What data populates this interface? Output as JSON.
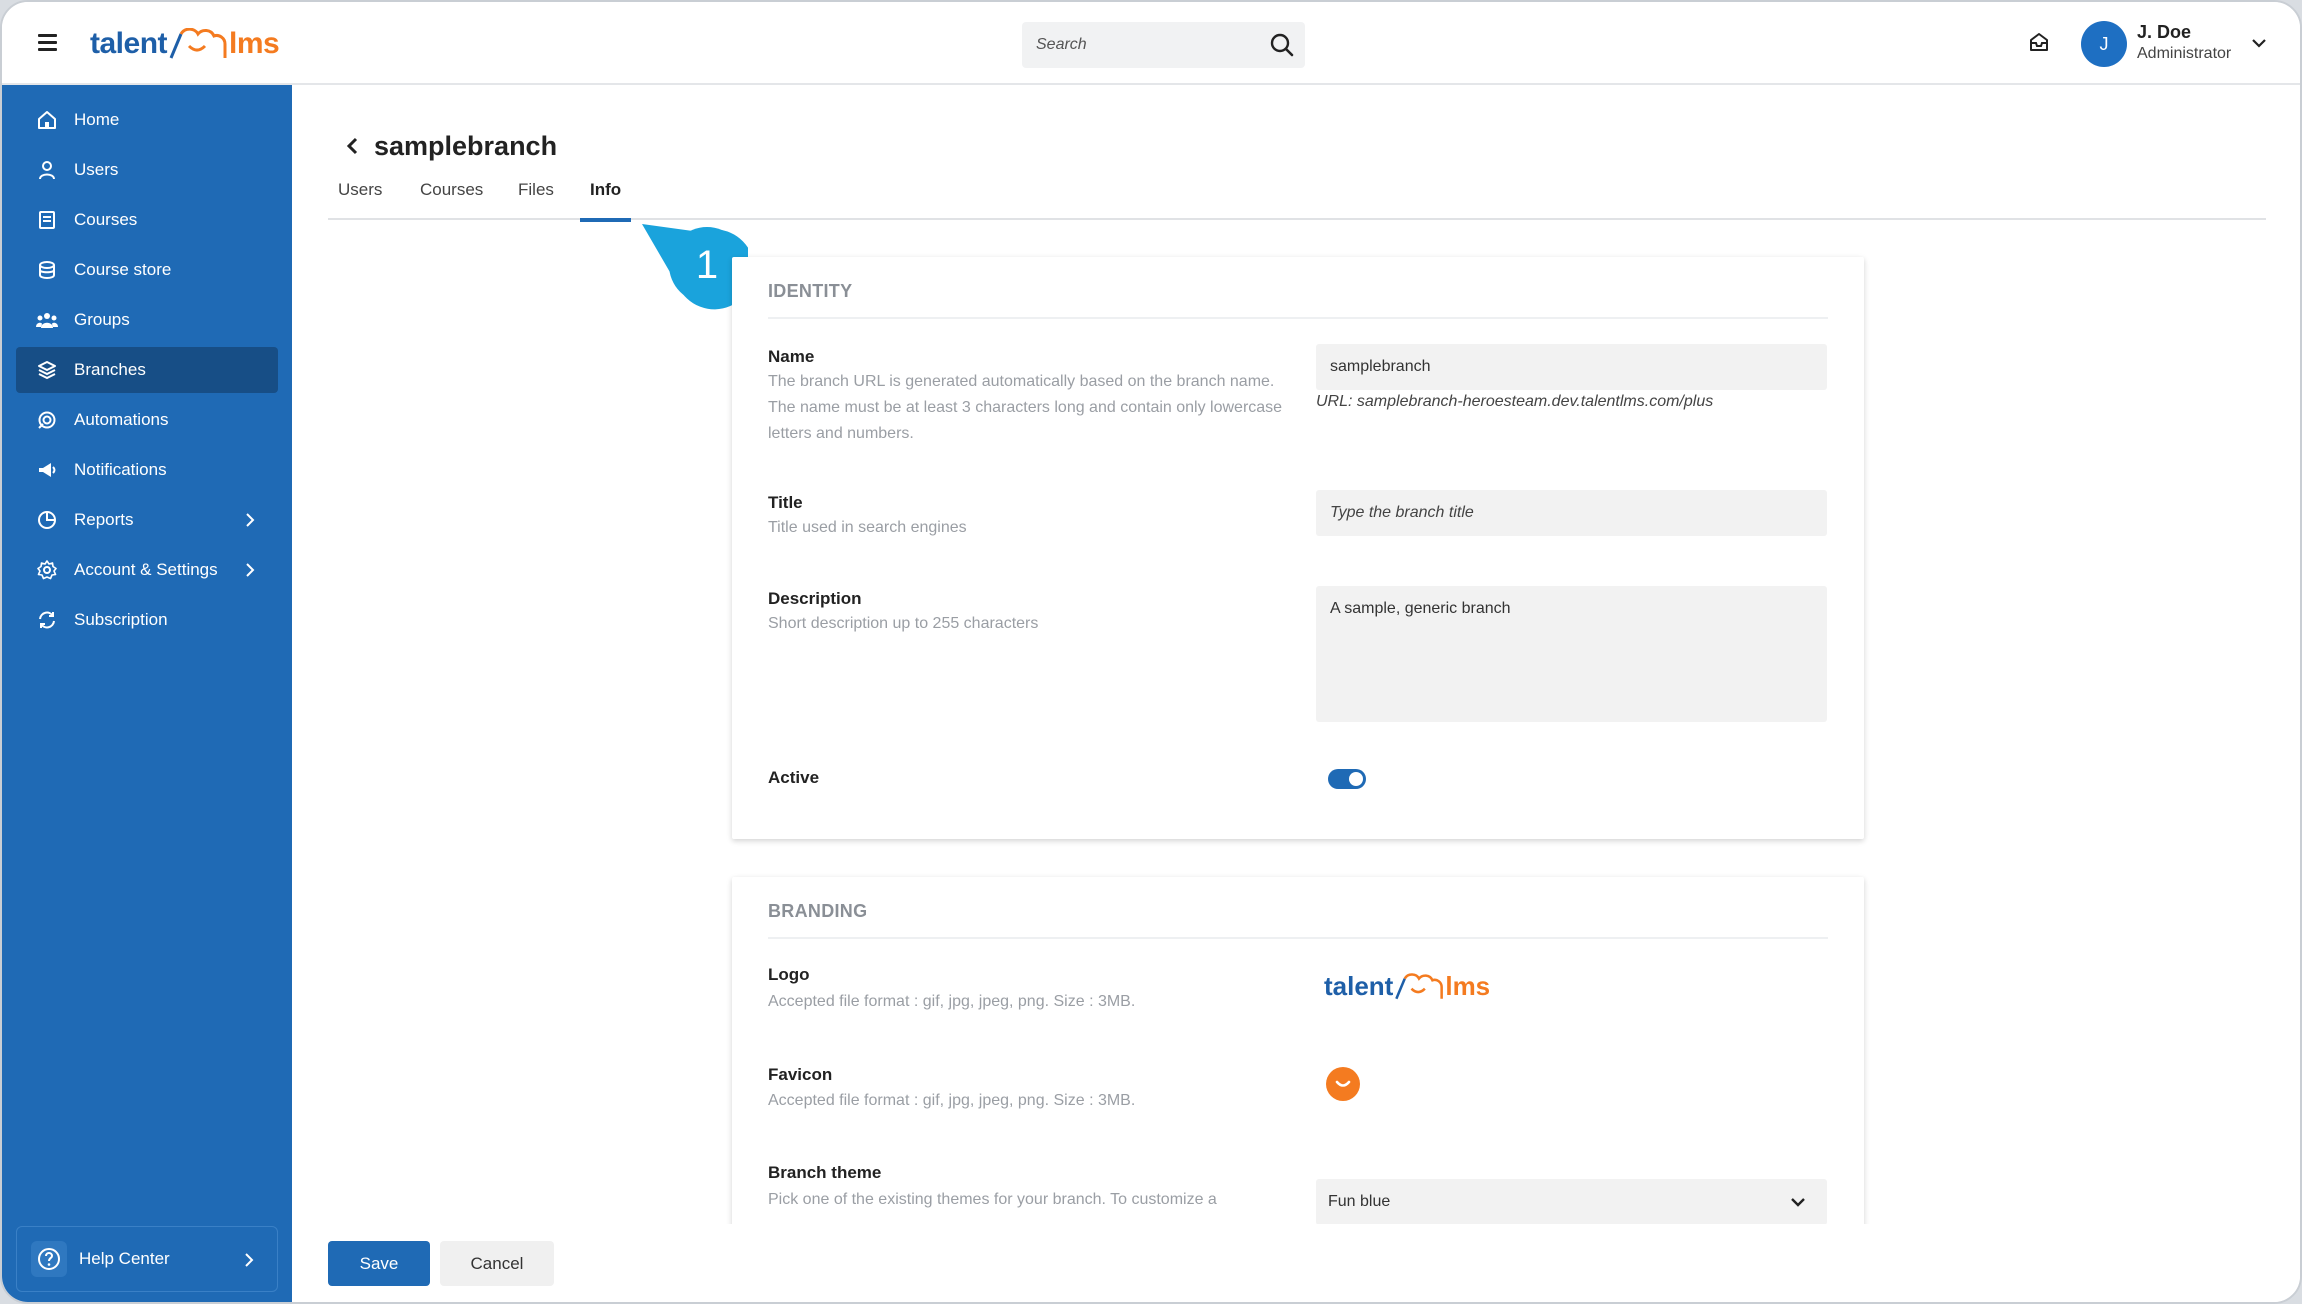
{
  "topbar": {
    "brand_left": "talent",
    "brand_right": "lms",
    "search_placeholder": "Search",
    "user_initial": "J",
    "user_name": "J. Doe",
    "user_role": "Administrator"
  },
  "sidebar": {
    "items": [
      {
        "label": "Home",
        "icon": "home-icon"
      },
      {
        "label": "Users",
        "icon": "user-icon"
      },
      {
        "label": "Courses",
        "icon": "book-icon"
      },
      {
        "label": "Course store",
        "icon": "store-icon"
      },
      {
        "label": "Groups",
        "icon": "groups-icon"
      },
      {
        "label": "Branches",
        "icon": "layers-icon",
        "active": true
      },
      {
        "label": "Automations",
        "icon": "automations-icon"
      },
      {
        "label": "Notifications",
        "icon": "megaphone-icon"
      },
      {
        "label": "Reports",
        "icon": "pie-chart-icon",
        "has_submenu": true
      },
      {
        "label": "Account & Settings",
        "icon": "gear-icon",
        "has_submenu": true
      },
      {
        "label": "Subscription",
        "icon": "subscription-icon"
      }
    ],
    "help_label": "Help Center"
  },
  "page": {
    "title": "samplebranch",
    "tabs": [
      "Users",
      "Courses",
      "Files",
      "Info"
    ],
    "active_tab": "Info",
    "callout_number": "1"
  },
  "identity": {
    "section_title": "IDENTITY",
    "name_label": "Name",
    "name_help": "The branch URL is generated automatically based on the branch name. The name must be at least 3 characters long and contain only lowercase letters and numbers.",
    "name_value": "samplebranch",
    "url_note": "URL: samplebranch-heroesteam.dev.talentlms.com/plus",
    "title_label": "Title",
    "title_help": "Title used in search engines",
    "title_placeholder": "Type the branch title",
    "description_label": "Description",
    "description_help": "Short description up to 255 characters",
    "description_value": "A sample, generic branch",
    "active_label": "Active",
    "active_on": true
  },
  "branding": {
    "section_title": "BRANDING",
    "logo_label": "Logo",
    "logo_help": "Accepted file format : gif, jpg, jpeg, png. Size : 3MB.",
    "logo_left": "talent",
    "logo_right": "lms",
    "favicon_label": "Favicon",
    "favicon_help": "Accepted file format : gif, jpg, jpeg, png. Size : 3MB.",
    "theme_label": "Branch theme",
    "theme_help": "Pick one of the existing themes for your branch. To customize a",
    "theme_value": "Fun blue"
  },
  "footer": {
    "save_label": "Save",
    "cancel_label": "Cancel"
  },
  "colors": {
    "primary": "#1f6ab5",
    "sidebar_active": "#174e86",
    "brand_orange": "#f47b20",
    "callout": "#1aa3dc"
  }
}
